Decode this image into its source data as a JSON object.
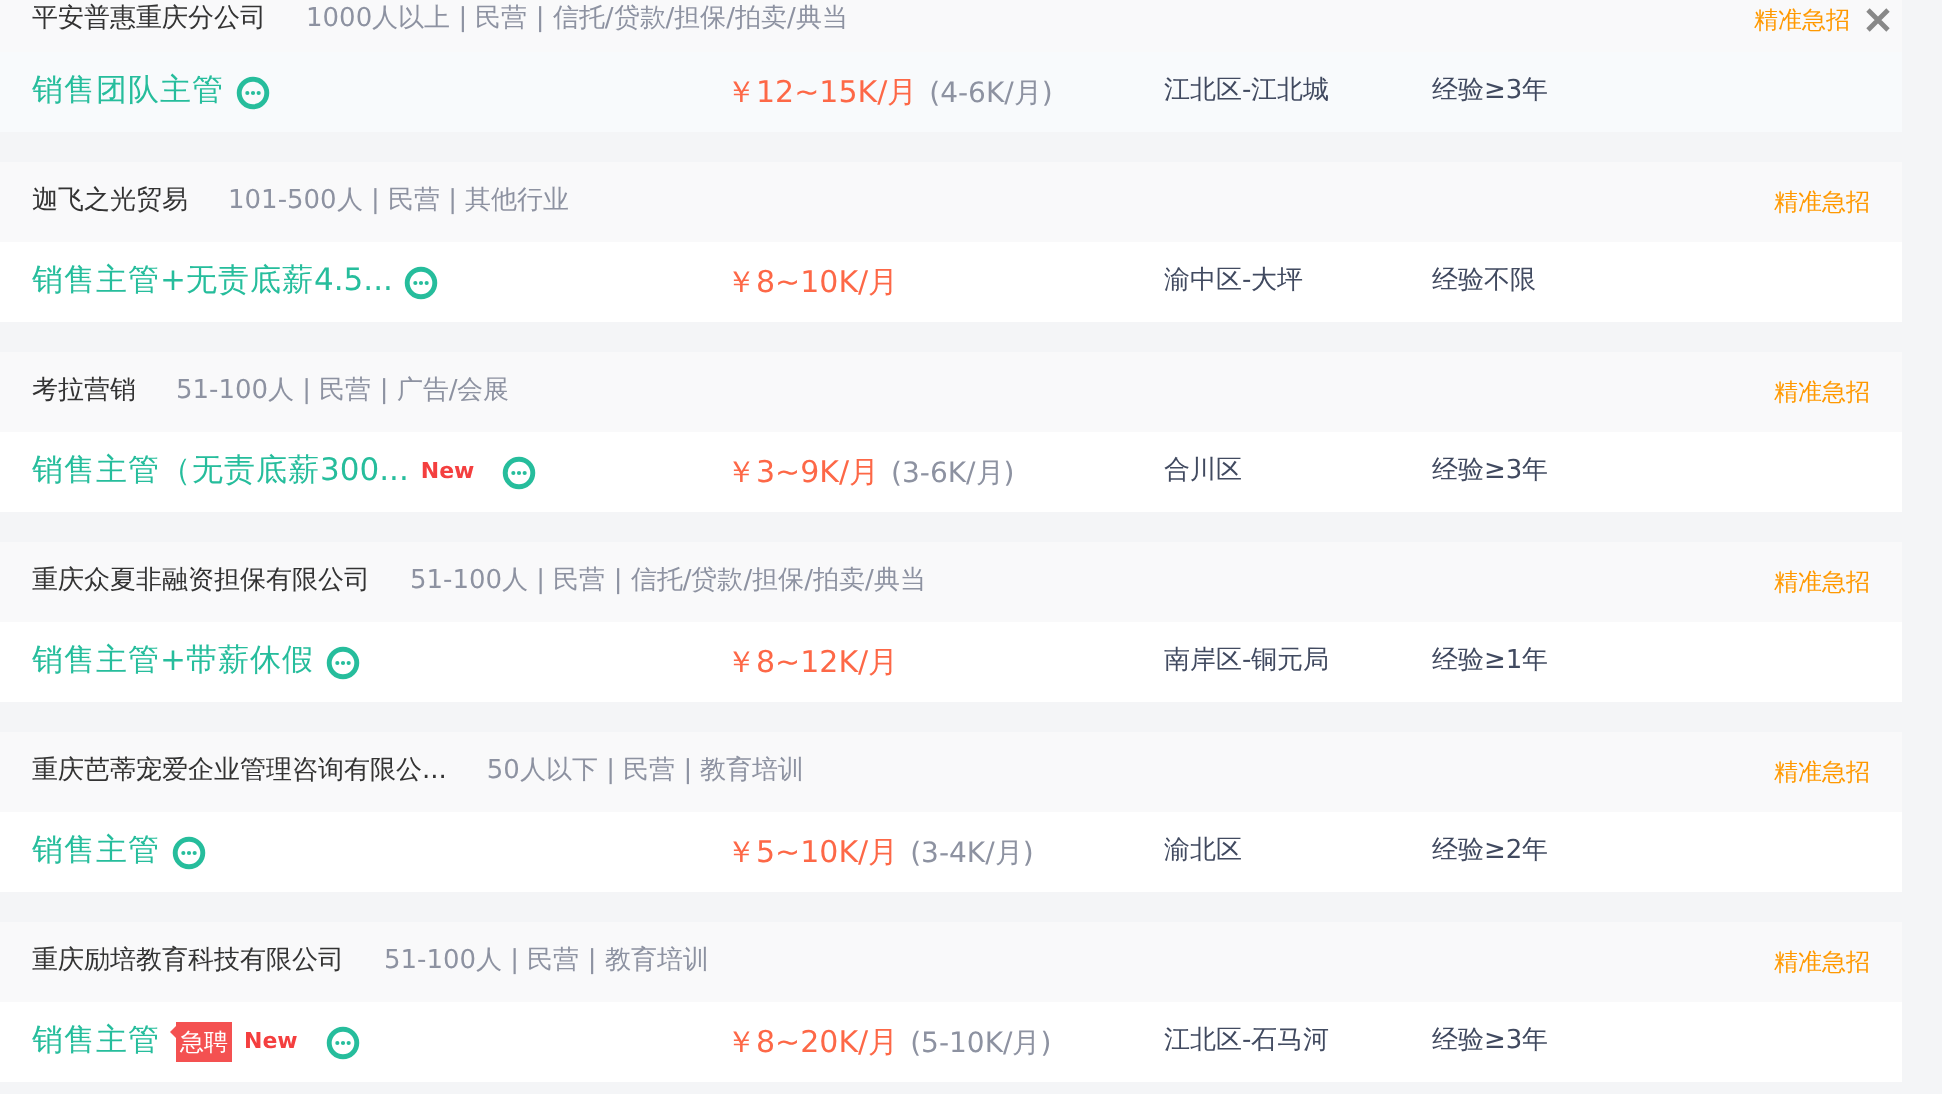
{
  "jobs": [
    {
      "company": "平安普惠重庆分公司",
      "company_info": "1000人以上 | 民营 | 信托/贷款/担保/拍卖/典当",
      "promo": "精准急招",
      "hovered": true,
      "title": "销售团队主管",
      "salary": "￥12~15K/月",
      "salary_note": "(4-6K/月)",
      "location": "江北区-江北城",
      "experience": "经验≥3年"
    },
    {
      "company": "迦飞之光贸易",
      "company_info": "101-500人 | 民营 | 其他行业",
      "promo": "精准急招",
      "hovered": false,
      "title": "销售主管+无责底薪4.5...",
      "salary": "￥8~10K/月",
      "location": "渝中区-大坪",
      "experience": "经验不限"
    },
    {
      "company": "考拉营销",
      "company_info": "51-100人 | 民营 | 广告/会展",
      "promo": "精准急招",
      "hovered": false,
      "title": "销售主管（无责底薪300...",
      "new_label": "New",
      "salary": "￥3~9K/月",
      "salary_note": "(3-6K/月)",
      "location": "合川区",
      "experience": "经验≥3年"
    },
    {
      "company": "重庆众夏非融资担保有限公司",
      "company_info": "51-100人 | 民营 | 信托/贷款/担保/拍卖/典当",
      "promo": "精准急招",
      "hovered": false,
      "title": "销售主管+带薪休假",
      "salary": "￥8~12K/月",
      "location": "南岸区-铜元局",
      "experience": "经验≥1年"
    },
    {
      "company": "重庆芭蒂宠爱企业管理咨询有限公...",
      "company_info": "50人以下 | 民营 | 教育培训",
      "promo": "精准急招",
      "hovered": false,
      "title": "销售主管",
      "salary": "￥5~10K/月",
      "salary_note": "(3-4K/月)",
      "location": "渝北区",
      "experience": "经验≥2年"
    },
    {
      "company": "重庆励培教育科技有限公司",
      "company_info": "51-100人 | 民营 | 教育培训",
      "promo": "精准急招",
      "hovered": false,
      "title": "销售主管",
      "urgent_tag": "急聘",
      "new_label": "New",
      "salary": "￥8~20K/月",
      "salary_note": "(5-10K/月)",
      "location": "江北区-石马河",
      "experience": "经验≥3年"
    }
  ]
}
